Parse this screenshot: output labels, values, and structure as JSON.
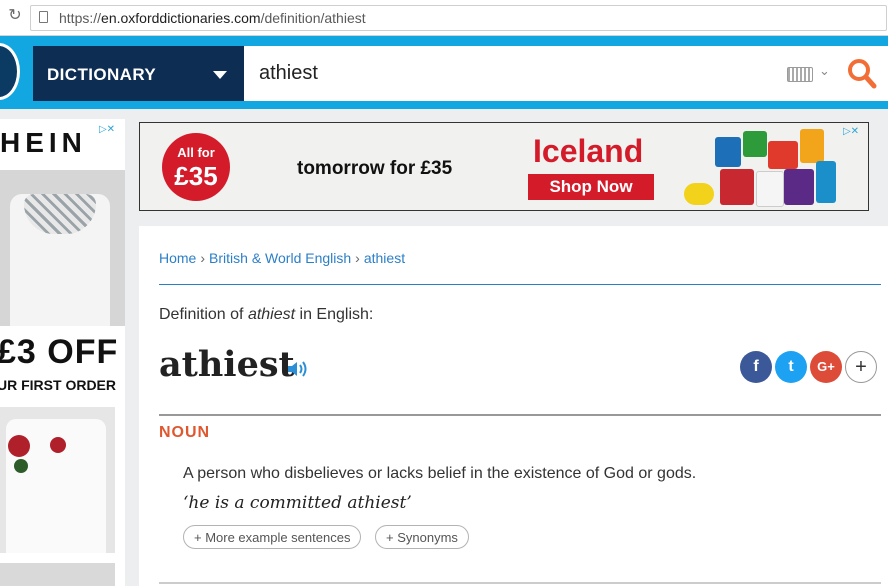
{
  "browser": {
    "url_scheme": "https://",
    "url_host": "en.oxforddictionaries.com",
    "url_path": "/definition/athiest",
    "reload_glyph": "↻"
  },
  "header": {
    "dictionary_label": "DICTIONARY",
    "search_value": "athiest",
    "keyboard_caret": "⌄",
    "accent_color": "#13a7e1",
    "search_icon_color": "#f26e36"
  },
  "left_ad": {
    "brand_fragment": "HEIN",
    "offer": "£3 OFF",
    "offer_sub": "UR FIRST ORDER",
    "adchoice": "▷✕"
  },
  "top_ad": {
    "circle_small": "All for",
    "circle_big": "£35",
    "tagline": "tomorrow for £35",
    "brand": "Iceland",
    "cta": "Shop Now",
    "adchoice": "▷✕"
  },
  "breadcrumb": {
    "items": [
      "Home",
      "British & World English",
      "athiest"
    ],
    "separator": "›"
  },
  "entry": {
    "definition_prefix": "Definition of ",
    "definition_word": "athiest",
    "definition_suffix": " in English:",
    "headword": "athiest",
    "share": [
      "f",
      "t",
      "G+",
      "+"
    ],
    "part_of_speech": "NOUN",
    "sense": "A person who disbelieves or lacks belief in the existence of God or gods.",
    "example": "‘he is a committed athiest’",
    "more_examples": "+ More example sentences",
    "synonyms": "+ Synonyms"
  }
}
